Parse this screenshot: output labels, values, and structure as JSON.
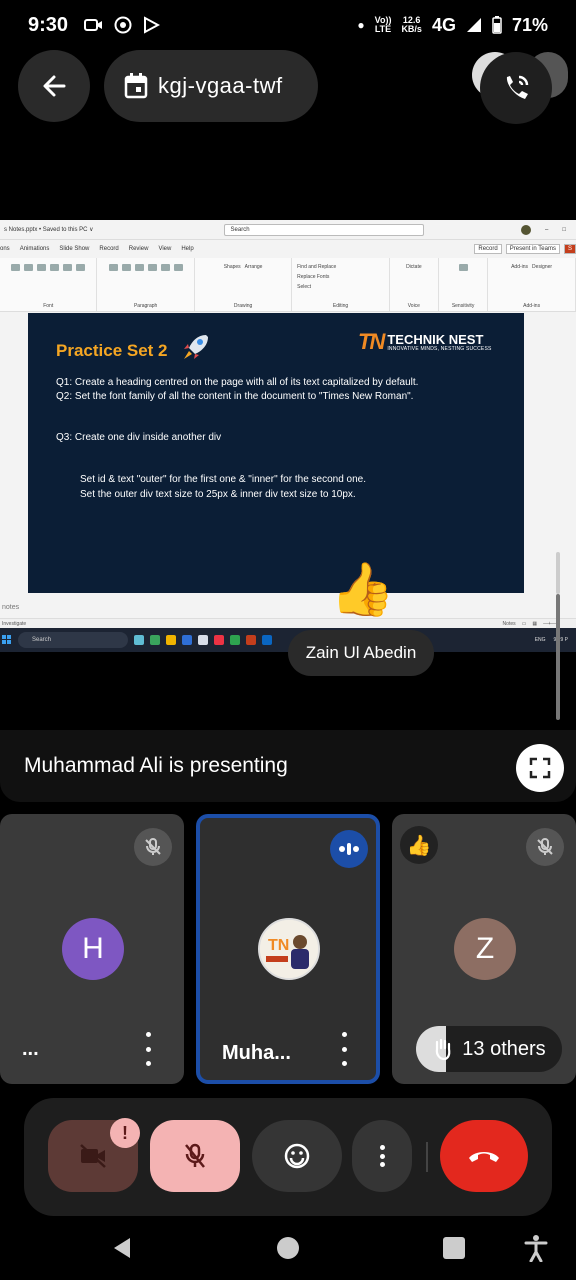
{
  "status": {
    "time": "9:30",
    "volte_top": "Vo))",
    "volte_bottom": "LTE",
    "speed_top": "12.6",
    "speed_bottom": "KB/s",
    "network": "4G",
    "battery": "71%"
  },
  "meeting": {
    "code": "kgj-vgaa-twf"
  },
  "ppt": {
    "file_title": "s Notes.pptx • Saved to this PC ∨",
    "search": "Search",
    "menu": [
      "ons",
      "Animations",
      "Slide Show",
      "Record",
      "Review",
      "View",
      "Help"
    ],
    "record_btn": "Record",
    "present_btn": "Present in Teams",
    "ribbon_groups": [
      "Font",
      "Paragraph",
      "Drawing",
      "Editing",
      "Voice",
      "Sensitivity",
      "Add-ins"
    ],
    "ribbon_items": [
      "Shapes",
      "Arrange",
      "Find and Replace",
      "Replace Fonts",
      "Select",
      "Dictate",
      "Add-ins",
      "Designer"
    ],
    "notes": "notes",
    "status_left": "Investigate",
    "status_right": "Notes",
    "taskbar_search": "Search",
    "taskbar_lang": "ENG",
    "taskbar_time": "9:29 P"
  },
  "slide": {
    "title": "Practice Set 2",
    "brand_name": "TECHNIK NEST",
    "brand_tag": "INNOVATIVE MINDS, NESTING SUCCESS",
    "q1": "Q1:  Create a heading centred on the page with all of its text capitalized by default.",
    "q2": "Q2:  Set the font family of all the content in the document to \"Times New Roman\".",
    "q3": "Q3:  Create one div inside another div",
    "q3a": "Set id & text \"outer\" for the first one & \"inner\" for the second one.",
    "q3b": "Set the outer div text size to 25px & inner div text size to 10px."
  },
  "share": {
    "reaction": "👍",
    "speaker": "Zain Ul Abedin",
    "presenting": "Muhammad Ali is presenting"
  },
  "tiles": [
    {
      "initial": "H",
      "name": "...",
      "avatar_color": "#7e57c2"
    },
    {
      "name": "Muha..."
    },
    {
      "initial": "Z",
      "reaction": "👍",
      "avatar_color": "#8d6e63"
    }
  ],
  "others": "13 others",
  "alert": "!",
  "colors": {
    "end_call": "#e3281e",
    "active_border": "#1c4ea8",
    "slide_bg": "#0b1e36",
    "slide_title": "#f5a623"
  }
}
